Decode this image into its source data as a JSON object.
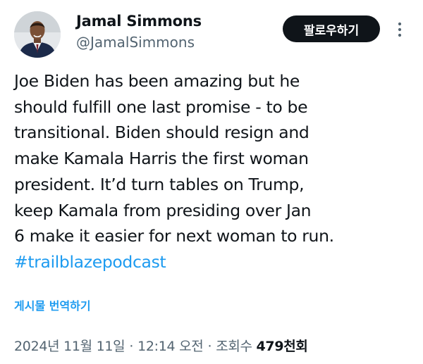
{
  "author": {
    "display_name": "Jamal Simmons",
    "handle": "@JamalSimmons"
  },
  "follow_label": "팔로우하기",
  "tweet": {
    "lines": [
      "Joe Biden has been amazing but he",
      "should fulfill one last promise - to be",
      "transitional. Biden should resign and",
      "make Kamala Harris the first woman",
      "president. It’d turn tables on Trump,",
      "keep Kamala from presiding over Jan",
      "6  make it easier for next woman to run."
    ],
    "hashtag": "#trailblazepodcast"
  },
  "translate_label": "게시물 번역하기",
  "meta": {
    "date": "2024년 11월 11일",
    "separator": "·",
    "time": "12:14 오전",
    "views_label": "조회수",
    "views_count": "479천회"
  },
  "icons": {
    "more": "more-vertical-icon"
  },
  "colors": {
    "link": "#1d9bf0",
    "text": "#0f1419",
    "secondary": "#536471",
    "button_bg": "#0f1419"
  }
}
